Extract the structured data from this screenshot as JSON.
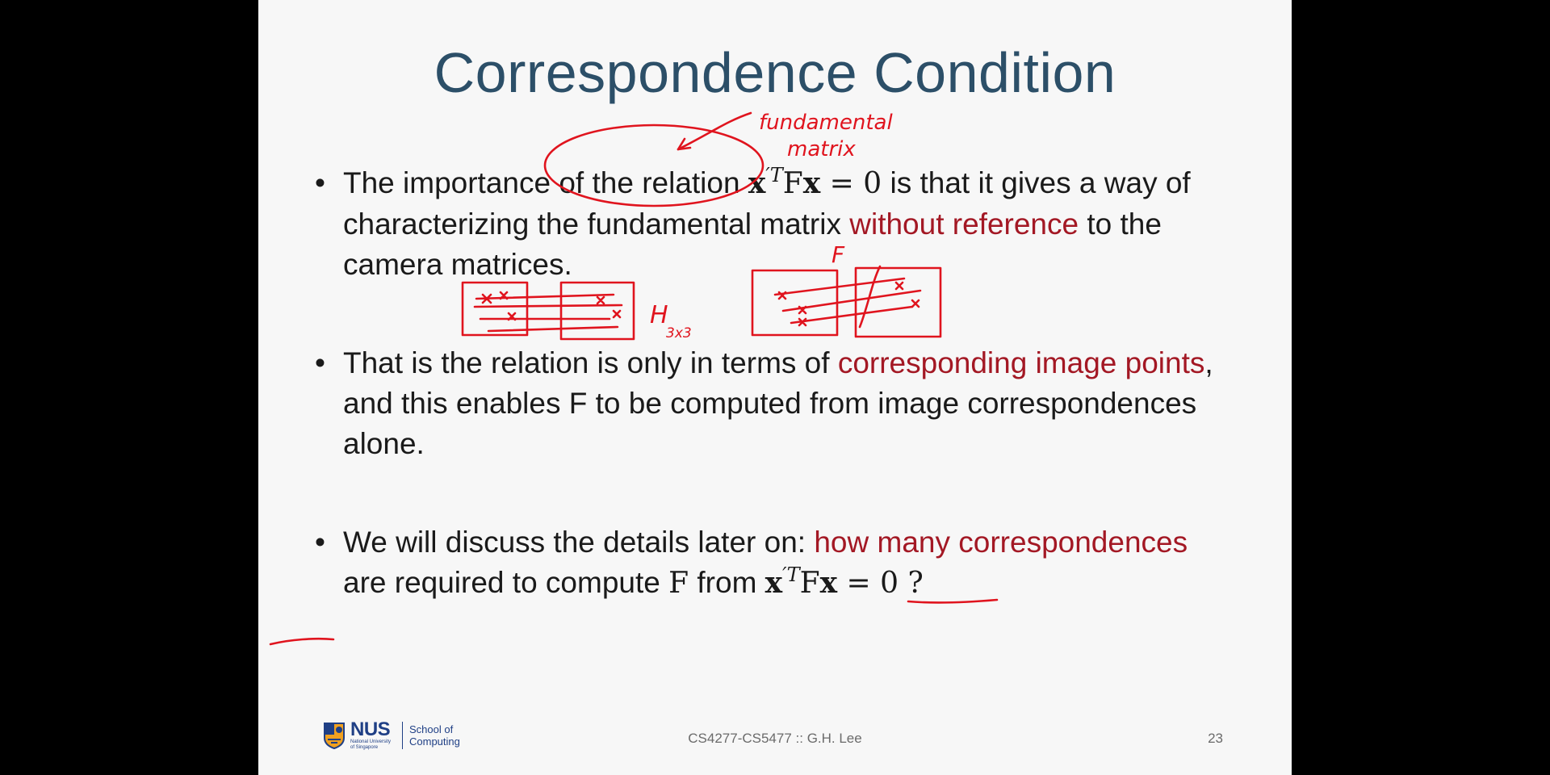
{
  "slide": {
    "title": "Correspondence Condition",
    "bullet_char": "•",
    "bullet1": {
      "part1": "The importance of the relation ",
      "math_x_prime": "x",
      "math_prime_T": "′T",
      "math_F": "F",
      "math_x": "x",
      "math_eq": " = 0",
      "part2": " is that it gives a way of characterizing the fundamental matrix ",
      "red": "without reference",
      "part3": " to the camera matrices."
    },
    "bullet2": {
      "part1": "That is the relation is only in terms of ",
      "red": "corresponding image points",
      "part2": ", and this enables F to be computed from image correspondences alone."
    },
    "bullet3": {
      "part1": "We will discuss the details later on: ",
      "red": "how many correspondences",
      "part2": " are required to compute ",
      "math_F": "F",
      "part3": " from ",
      "math_x_prime": "x",
      "math_prime_T": "′T",
      "math_F2": "F",
      "math_x": "x",
      "math_eq": " = 0 ?"
    },
    "annotations": {
      "fundamental": "fundamental",
      "matrix": "matrix",
      "H": "H",
      "H_sub": "3x3",
      "F": "F",
      "ink_color": "#e0141e"
    }
  },
  "footer": {
    "logo_word": "NUS",
    "logo_sub": "National University of Singapore",
    "school": "School of Computing",
    "course": "CS4277-CS5477 :: G.H. Lee",
    "page": "23"
  },
  "colors": {
    "title": "#2c4f68",
    "emphasis_red": "#a31824",
    "background": "#f7f7f7",
    "letterbox": "#000000"
  }
}
